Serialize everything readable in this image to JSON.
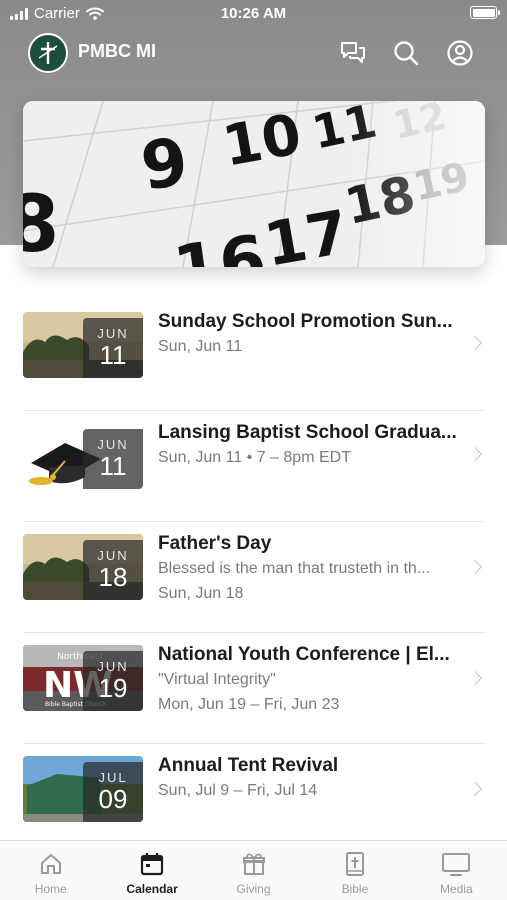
{
  "status_bar": {
    "carrier": "Carrier",
    "time": "10:26 AM"
  },
  "app": {
    "title": "PMBC MI",
    "icons": {
      "logo": "cross-logo-icon",
      "chat": "chat-bubbles-icon",
      "search": "search-icon",
      "account": "account-icon"
    }
  },
  "hero": {
    "calendar_numbers": [
      "8",
      "9",
      "10",
      "11",
      "12",
      "16",
      "17",
      "18",
      "19"
    ]
  },
  "events": [
    {
      "month": "JUN",
      "day": "11",
      "title": "Sunday School Promotion Sun...",
      "lines": [
        "Sun, Jun 11"
      ],
      "thumb": "sunset-trees"
    },
    {
      "month": "JUN",
      "day": "11",
      "title": "Lansing Baptist School Gradua...",
      "lines": [
        "Sun, Jun 11 • 7 – 8pm EDT"
      ],
      "thumb": "graduation-cap"
    },
    {
      "month": "JUN",
      "day": "18",
      "title": "Father's Day",
      "lines": [
        "Blessed is the man that trusteth in th...",
        "Sun, Jun 18"
      ],
      "thumb": "sunset-trees"
    },
    {
      "month": "JUN",
      "day": "19",
      "title": "National Youth Conference | El...",
      "lines": [
        "\"Virtual Integrity\"",
        "Mon, Jun 19 – Fri, Jun 23"
      ],
      "thumb": "northwest-sign",
      "thumb_text": {
        "top": "Northwest",
        "bottom": "Bible Baptist Church"
      }
    },
    {
      "month": "JUL",
      "day": "09",
      "title": "Annual Tent Revival",
      "lines": [
        "Sun, Jul 9 – Fri, Jul 14"
      ],
      "thumb": "tent-field"
    }
  ],
  "tabs": [
    {
      "label": "Home",
      "icon": "home-icon",
      "active": false
    },
    {
      "label": "Calendar",
      "icon": "calendar-icon",
      "active": true
    },
    {
      "label": "Giving",
      "icon": "gift-icon",
      "active": false
    },
    {
      "label": "Bible",
      "icon": "bible-icon",
      "active": false
    },
    {
      "label": "Media",
      "icon": "tv-icon",
      "active": false
    }
  ],
  "colors": {
    "header_gray": "#8a8a8a",
    "logo_green": "#1f4d3b",
    "secondary_text": "#7b7b7f",
    "active_tab": "#1c1c1e",
    "inactive_tab": "#9a9a9e"
  }
}
